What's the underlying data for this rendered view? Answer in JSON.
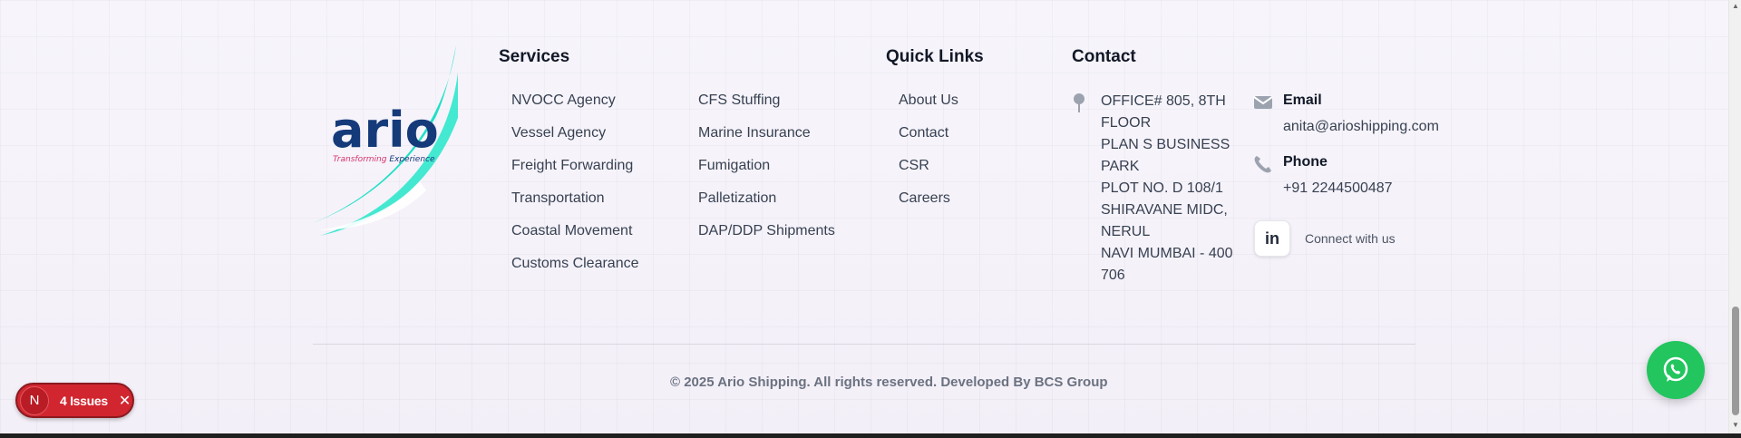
{
  "logo": {
    "wordmark": "ario",
    "tagline_part1": "Transforming ",
    "tagline_part2": "Experience",
    "colors": {
      "wordmark": "#153a7a",
      "swoosh": "#1fe0c6",
      "tagline_pink": "#d6336c"
    }
  },
  "services": {
    "title": "Services",
    "column1": [
      "NVOCC Agency",
      "Vessel Agency",
      "Freight Forwarding",
      "Transportation",
      "Coastal Movement",
      "Customs Clearance"
    ],
    "column2": [
      "CFS Stuffing",
      "Marine Insurance",
      "Fumigation",
      "Palletization",
      "DAP/DDP Shipments"
    ]
  },
  "quick_links": {
    "title": "Quick Links",
    "items": [
      "About Us",
      "Contact",
      "CSR",
      "Careers"
    ]
  },
  "contact": {
    "title": "Contact",
    "address_lines": [
      "OFFICE# 805, 8TH",
      "FLOOR",
      "PLAN S BUSINESS",
      "PARK",
      "PLOT NO. D 108/1",
      "SHIRAVANE MIDC,",
      "NERUL",
      "NAVI MUMBAI - 400",
      "706"
    ],
    "email_label": "Email",
    "email_value": "anita@arioshipping.com",
    "phone_label": "Phone",
    "phone_value": "+91 2244500487",
    "linkedin_label": "in",
    "connect_text": "Connect with us"
  },
  "footer": {
    "copyright": "© 2025 Ario Shipping. All rights reserved. Developed By BCS Group"
  },
  "dev_badge": {
    "avatar_letter": "N",
    "issues_text": "4 Issues",
    "close_glyph": "✕"
  },
  "colors": {
    "whatsapp": "#22c55e",
    "issues_badge": "#d1262f"
  },
  "icons": [
    "map-pin-icon",
    "envelope-icon",
    "phone-icon",
    "linkedin-icon",
    "whatsapp-icon"
  ]
}
